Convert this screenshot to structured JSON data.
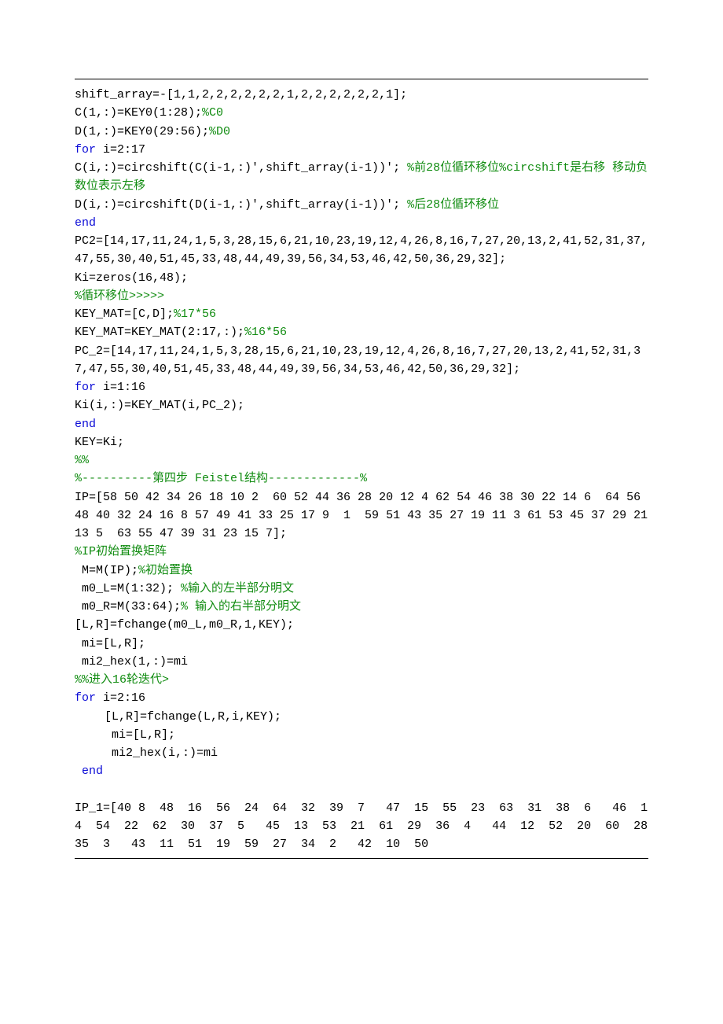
{
  "lines": [
    {
      "parts": [
        {
          "t": "shift_array=-[1,1,2,2,2,2,2,2,1,2,2,2,2,2,2,1];"
        }
      ]
    },
    {
      "parts": [
        {
          "t": "C(1,:)=KEY0(1:28);"
        },
        {
          "t": "%C0",
          "cls": "c"
        }
      ]
    },
    {
      "parts": [
        {
          "t": "D(1,:)=KEY0(29:56);"
        },
        {
          "t": "%D0",
          "cls": "c"
        }
      ]
    },
    {
      "parts": [
        {
          "t": "for ",
          "cls": "k"
        },
        {
          "t": "i=2:17"
        }
      ]
    },
    {
      "parts": [
        {
          "t": "C(i,:)=circshift(C(i-1,:)',shift_array(i-1))'; "
        },
        {
          "t": "%前28位循环移位%circshift是右移 移动负数位表示左移",
          "cls": "c"
        }
      ]
    },
    {
      "parts": [
        {
          "t": "D(i,:)=circshift(D(i-1,:)',shift_array(i-1))'; "
        },
        {
          "t": "%后28位循环移位",
          "cls": "c"
        }
      ]
    },
    {
      "parts": [
        {
          "t": "end",
          "cls": "k"
        }
      ]
    },
    {
      "parts": [
        {
          "t": "PC2=[14,17,11,24,1,5,3,28,15,6,21,10,23,19,12,4,26,8,16,7,27,20,13,2,41,52,31,37,47,55,30,40,51,45,33,48,44,49,39,56,34,53,46,42,50,36,29,32];"
        }
      ]
    },
    {
      "parts": [
        {
          "t": "Ki=zeros(16,48);"
        }
      ]
    },
    {
      "parts": [
        {
          "t": "%循环移位>>>>>",
          "cls": "c"
        }
      ]
    },
    {
      "parts": [
        {
          "t": "KEY_MAT=[C,D];"
        },
        {
          "t": "%17*56",
          "cls": "c"
        }
      ]
    },
    {
      "parts": [
        {
          "t": "KEY_MAT=KEY_MAT(2:17,:);"
        },
        {
          "t": "%16*56",
          "cls": "c"
        }
      ]
    },
    {
      "parts": [
        {
          "t": "PC_2=[14,17,11,24,1,5,3,28,15,6,21,10,23,19,12,4,26,8,16,7,27,20,13,2,41,52,31,37,47,55,30,40,51,45,33,48,44,49,39,56,34,53,46,42,50,36,29,32];"
        }
      ]
    },
    {
      "parts": [
        {
          "t": "for ",
          "cls": "k"
        },
        {
          "t": "i=1:16"
        }
      ]
    },
    {
      "parts": [
        {
          "t": "Ki(i,:)=KEY_MAT(i,PC_2);"
        }
      ]
    },
    {
      "parts": [
        {
          "t": "end",
          "cls": "k"
        }
      ]
    },
    {
      "parts": [
        {
          "t": "KEY=Ki;"
        }
      ]
    },
    {
      "parts": [
        {
          "t": "%%",
          "cls": "c"
        }
      ]
    },
    {
      "parts": [
        {
          "t": "%----------第四步 Feistel结构-------------%",
          "cls": "c"
        }
      ]
    },
    {
      "parts": [
        {
          "t": "IP=[58 50 42 34 26 18 10 2  60 52 44 36 28 20 12 4 62 54 46 38 30 22 14 6  64 56 48 40 32 24 16 8 57 49 41 33 25 17 9  1  59 51 43 35 27 19 11 3 61 53 45 37 29 21 13 5  63 55 47 39 31 23 15 7];"
        }
      ]
    },
    {
      "parts": [
        {
          "t": "%IP初始置换矩阵",
          "cls": "c"
        }
      ]
    },
    {
      "parts": [
        {
          "t": " M=M(IP);"
        },
        {
          "t": "%初始置换",
          "cls": "c"
        }
      ]
    },
    {
      "parts": [
        {
          "t": " m0_L=M(1:32); "
        },
        {
          "t": "%输入的左半部分明文",
          "cls": "c"
        }
      ]
    },
    {
      "parts": [
        {
          "t": " m0_R=M(33:64);"
        },
        {
          "t": "% 输入的右半部分明文",
          "cls": "c"
        }
      ]
    },
    {
      "parts": [
        {
          "t": "[L,R]=fchange(m0_L,m0_R,1,KEY);"
        }
      ]
    },
    {
      "parts": [
        {
          "t": " mi=[L,R];"
        }
      ]
    },
    {
      "parts": [
        {
          "t": " mi2_hex(1,:)=mi"
        }
      ]
    },
    {
      "parts": [
        {
          "t": "%%进入16轮迭代>",
          "cls": "c"
        }
      ]
    },
    {
      "parts": [
        {
          "t": "for ",
          "cls": "k"
        },
        {
          "t": "i=2:16"
        }
      ]
    },
    {
      "parts": [
        {
          "t": "[L,R]=fchange(L,R,i,KEY);"
        }
      ],
      "cls": "indent1"
    },
    {
      "parts": [
        {
          "t": " mi=[L,R];"
        }
      ],
      "cls": "indent1"
    },
    {
      "parts": [
        {
          "t": " mi2_hex(i,:)=mi"
        }
      ],
      "cls": "indent1"
    },
    {
      "parts": [
        {
          "t": "end",
          "cls": "k"
        }
      ],
      "cls": "indent05"
    },
    {
      "spacer": true
    },
    {
      "parts": [
        {
          "t": "IP_1=[40 8  48  16  56  24  64  32  39  7   47  15  55  23  63  31  38  6   46  14  54  22  62  30  37  5   45  13  53  21  61  29  36  4   44  12  52  20  60  28  35  3   43  11  51  19  59  27  34  2   42  10  50  "
        }
      ]
    }
  ]
}
